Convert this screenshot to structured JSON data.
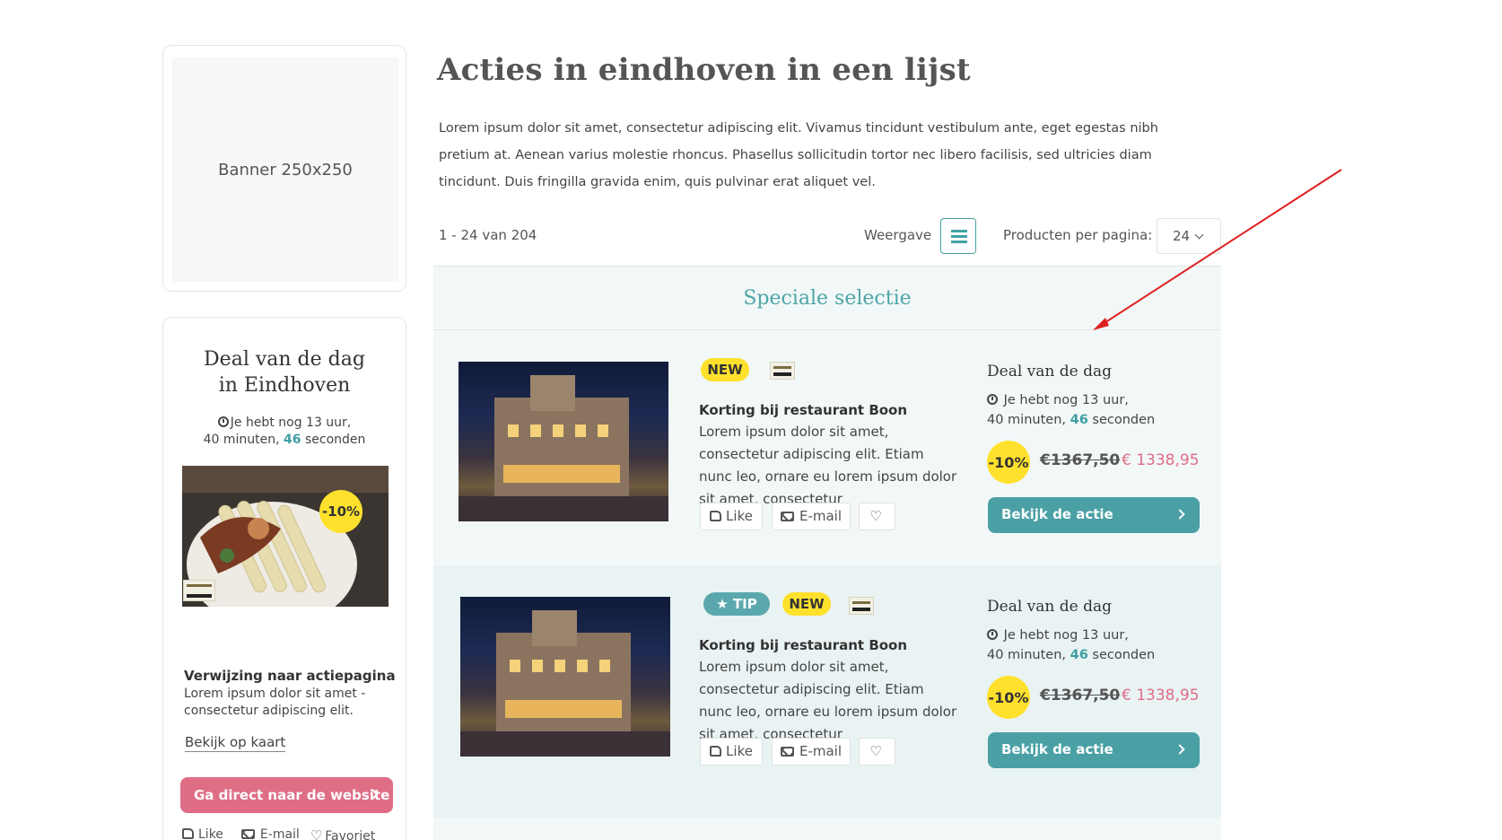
{
  "sidebar": {
    "banner": {
      "label": "Banner 250x250"
    },
    "deal": {
      "title_line1": "Deal van de dag",
      "title_line2": "in Eindhoven",
      "timer_pre": "Je hebt nog 13 uur,",
      "timer_mid": "40 minuten, ",
      "timer_seconds": "46",
      "timer_post": " seconden",
      "discount": "-10%",
      "link_title": "Verwijzing naar actiepagina",
      "description": "Lorem ipsum dolor sit amet - consectetur adipiscing elit.",
      "map_link": "Bekijk op kaart",
      "website_button": "Ga direct naar de website",
      "actions": {
        "like": "Like",
        "email": "E-mail",
        "favorite": "Favoriet"
      }
    }
  },
  "main": {
    "title": "Acties in eindhoven in een lijst",
    "intro": "Lorem ipsum dolor sit amet, consectetur adipiscing elit. Vivamus tincidunt vestibulum ante, eget egestas nibh pretium at. Aenean varius molestie rhoncus. Phasellus sollicitudin tortor nec libero facilisis, sed ultricies diam tincidunt. Duis fringilla gravida enim, quis pulvinar erat aliquet vel.",
    "result_count": "1 - 24 van 204",
    "view_label": "Weergave",
    "per_page_label": "Producten per pagina:",
    "per_page_value": "24",
    "section_title": "Speciale selectie",
    "items": [
      {
        "badge_new": "NEW",
        "title": "Korting bij restaurant Boon",
        "description": "Lorem ipsum dolor sit amet, consectetur adipiscing elit. Etiam nunc leo, ornare eu lorem ipsum dolor sit amet, consectetur",
        "like": "Like",
        "email": "E-mail",
        "deal_heading": "Deal van de dag",
        "timer_pre": "Je hebt nog 13 uur,",
        "timer_mid": "40 minuten, ",
        "timer_seconds": "46",
        "timer_post": " seconden",
        "discount": "-10%",
        "old_price": "€1367,50",
        "new_price": "€ 1338,95",
        "cta": "Bekijk de actie"
      },
      {
        "badge_tip": "TIP",
        "badge_new": "NEW",
        "title": "Korting bij restaurant Boon",
        "description": "Lorem ipsum dolor sit amet, consectetur adipiscing elit. Etiam nunc leo, ornare eu lorem ipsum dolor sit amet, consectetur",
        "like": "Like",
        "email": "E-mail",
        "deal_heading": "Deal van de dag",
        "timer_pre": "Je hebt nog 13 uur,",
        "timer_mid": "40 minuten, ",
        "timer_seconds": "46",
        "timer_post": " seconden",
        "discount": "-10%",
        "old_price": "€1367,50",
        "new_price": "€ 1338,95",
        "cta": "Bekijk de actie"
      }
    ]
  },
  "colors": {
    "accent_teal": "#4aa0a5",
    "accent_pink": "#df6d86",
    "badge_yellow": "#ffe12d",
    "annotation_arrow": "#e02020"
  },
  "icons": [
    "clock-icon",
    "list-view-icon",
    "chevron-down-icon",
    "chevron-right-icon",
    "thumbs-up-icon",
    "mail-icon",
    "heart-icon",
    "star-icon",
    "restaurant-logo"
  ]
}
